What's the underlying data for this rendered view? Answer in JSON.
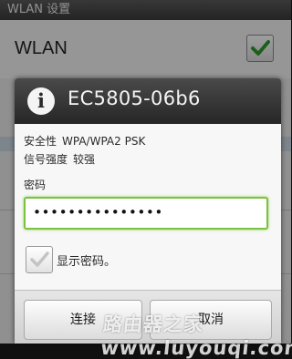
{
  "screen": {
    "title": "WLAN 设置",
    "wlan_label": "WLAN",
    "wlan_enabled": true
  },
  "dialog": {
    "icon": "info-icon",
    "title": "EC5805-06b6",
    "security_label": "安全性",
    "security_value": "WPA/WPA2 PSK",
    "signal_label": "信号强度",
    "signal_value": "较强",
    "password_label": "密码",
    "password_value": "•••••••••••••••",
    "show_password_label": "显示密码。",
    "show_password_checked": false,
    "connect_button": "连接",
    "cancel_button": "取消"
  },
  "colors": {
    "input_focus": "#7bc142",
    "check_green": "#2e9a2e",
    "header_dark": "#262626"
  },
  "watermark": "路由器之家 www.luyouqi.com"
}
